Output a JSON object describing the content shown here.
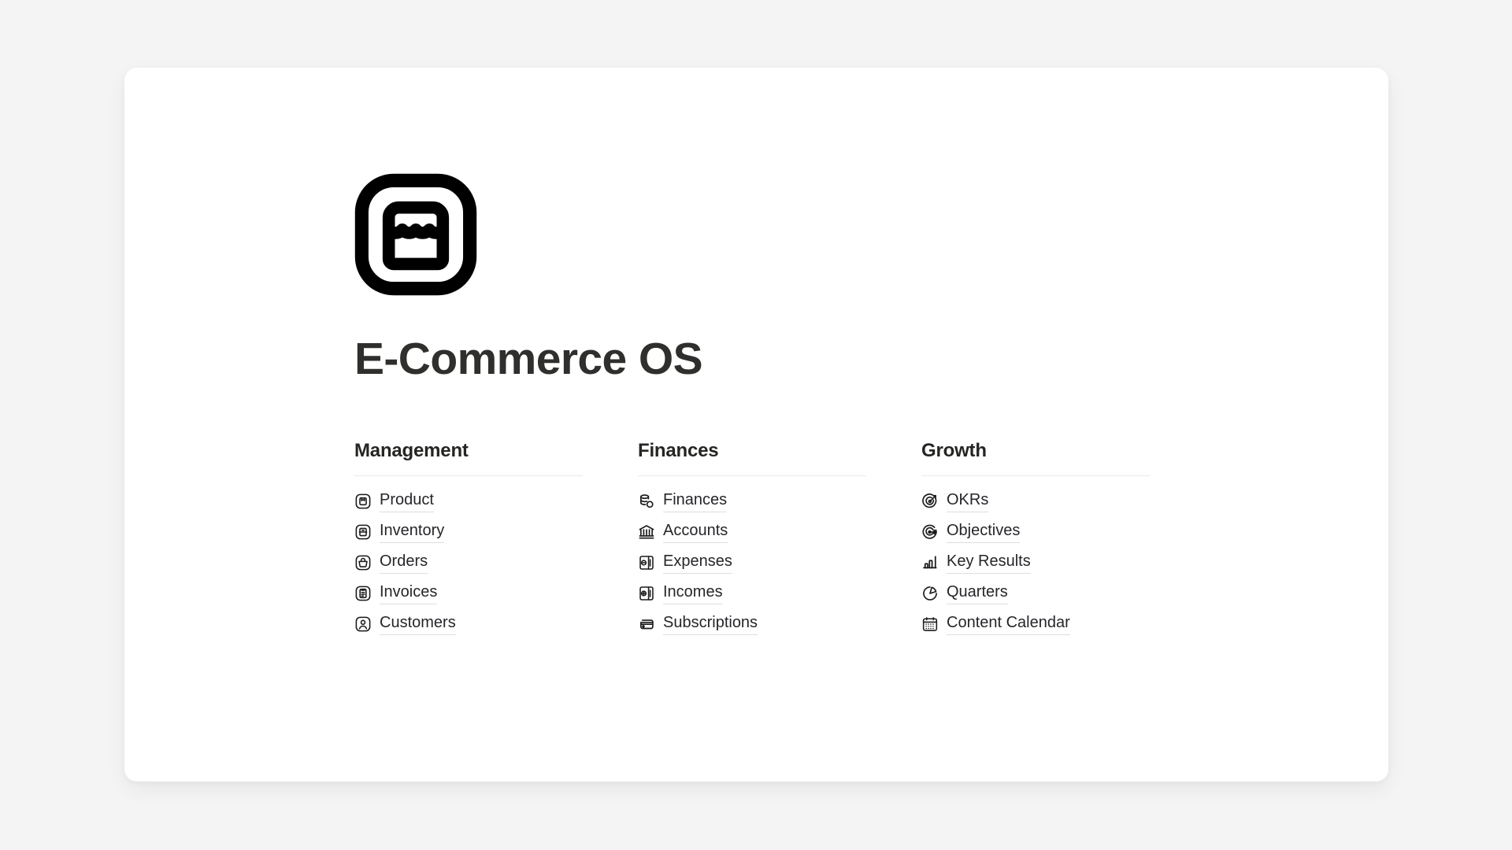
{
  "app": {
    "title": "E-Commerce OS",
    "logo_icon": "store-rounded-square-icon",
    "background_color": "#f4f4f4",
    "card_color": "#ffffff",
    "title_color": "#2f2f2d",
    "link_color": "#26262a",
    "divider_color": "#e8e8e8",
    "underline_color": "#dedede"
  },
  "columns": [
    {
      "title": "Management",
      "items": [
        {
          "label": "Product",
          "icon": "package-box-icon"
        },
        {
          "label": "Inventory",
          "icon": "inventory-box-icon"
        },
        {
          "label": "Orders",
          "icon": "shopping-basket-icon"
        },
        {
          "label": "Invoices",
          "icon": "invoice-clipboard-icon"
        },
        {
          "label": "Customers",
          "icon": "user-person-icon"
        }
      ]
    },
    {
      "title": "Finances",
      "items": [
        {
          "label": "Finances",
          "icon": "coins-stack-icon"
        },
        {
          "label": "Accounts",
          "icon": "bank-building-icon"
        },
        {
          "label": "Expenses",
          "icon": "receipt-minus-icon"
        },
        {
          "label": "Incomes",
          "icon": "receipt-plus-icon"
        },
        {
          "label": "Subscriptions",
          "icon": "credit-cards-icon"
        }
      ]
    },
    {
      "title": "Growth",
      "items": [
        {
          "label": "OKRs",
          "icon": "target-arrow-icon"
        },
        {
          "label": "Objectives",
          "icon": "target-goal-icon"
        },
        {
          "label": "Key Results",
          "icon": "bar-chart-icon"
        },
        {
          "label": "Quarters",
          "icon": "pie-chart-icon"
        },
        {
          "label": "Content Calendar",
          "icon": "calendar-grid-icon"
        }
      ]
    }
  ]
}
